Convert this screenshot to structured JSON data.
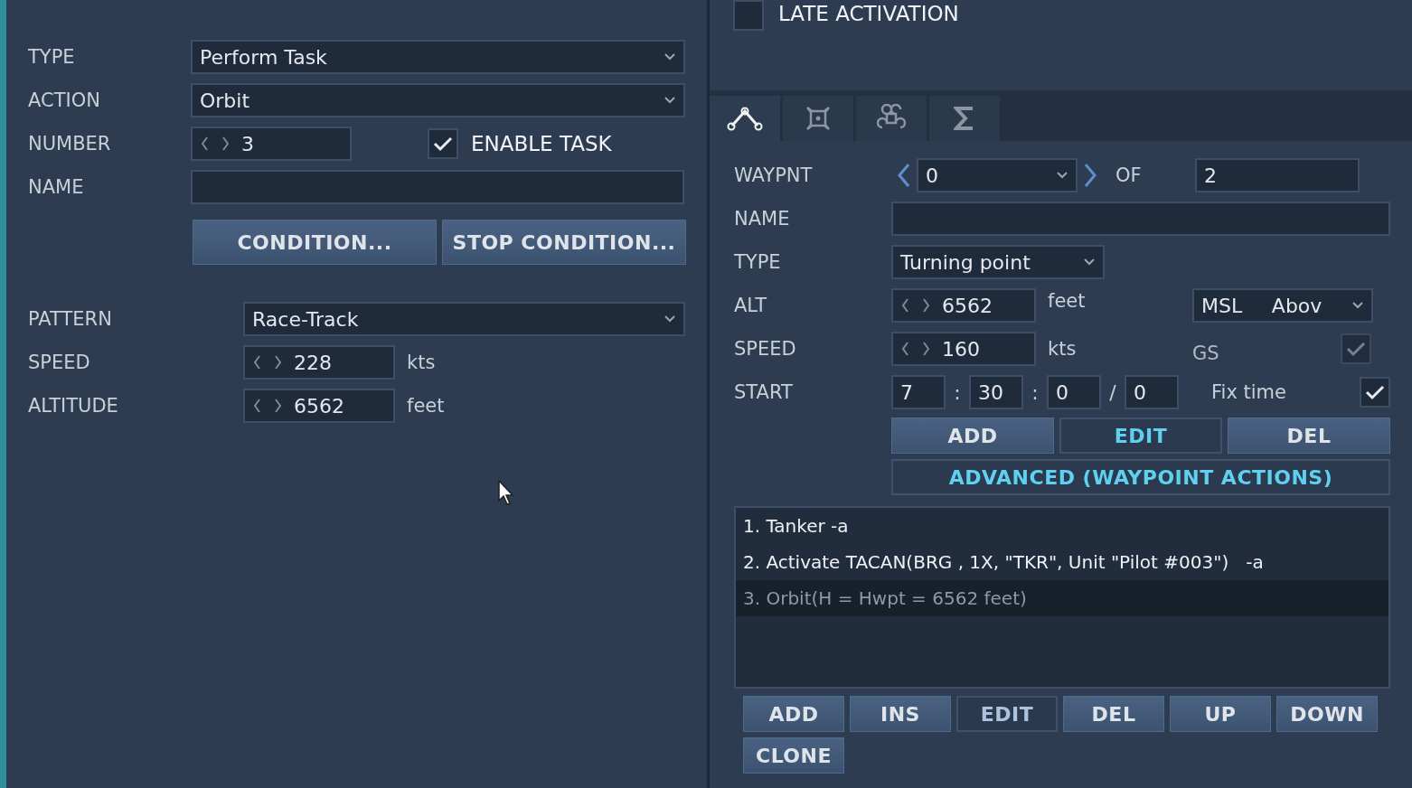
{
  "task": {
    "type": {
      "label": "TYPE",
      "value": "Perform Task"
    },
    "action": {
      "label": "ACTION",
      "value": "Orbit"
    },
    "number": {
      "label": "NUMBER",
      "value": "3"
    },
    "enable_task": {
      "label": "ENABLE TASK",
      "checked": true
    },
    "name": {
      "label": "NAME"
    },
    "buttons": [
      {
        "label": "CONDITION..."
      },
      {
        "label": "STOP CONDITION..."
      }
    ]
  },
  "orbit": {
    "pattern": {
      "label": "PATTERN",
      "value": "Race-Track"
    },
    "speed": {
      "label": "SPEED",
      "value": "228",
      "unit": "kts"
    },
    "altitude": {
      "label": "ALTITUDE",
      "value": "6562",
      "unit": "feet"
    }
  },
  "late_activation": {
    "label": "LATE ACTIVATION",
    "checked": false
  },
  "tabs": [
    {
      "kind": "route",
      "selected": true
    },
    {
      "kind": "target",
      "selected": false
    },
    {
      "kind": "command",
      "selected": false
    },
    {
      "kind": "sum",
      "selected": false
    }
  ],
  "waypoint": {
    "waypnt": {
      "label": "WAYPNT",
      "value": "0"
    },
    "of": {
      "label": "OF",
      "value": "2"
    },
    "name": {
      "label": "NAME"
    },
    "type": {
      "label": "TYPE",
      "value": "Turning point"
    },
    "alt": {
      "label": "ALT",
      "value": "6562",
      "unit": "feet",
      "ref": "MSL",
      "ref_mode": "Abov"
    },
    "speed": {
      "label": "SPEED",
      "value": "160",
      "unit": "kts"
    },
    "gs": {
      "label": "GS",
      "checked": true,
      "disabled": true
    },
    "start": {
      "label": "START",
      "parts": [
        "7",
        "30",
        "0",
        "0"
      ],
      "separators": [
        ":",
        ":",
        "/"
      ]
    },
    "fix_time": {
      "label": "Fix time",
      "checked": true,
      "disabled": false
    },
    "buttons": [
      {
        "label": "ADD",
        "kind": "raised"
      },
      {
        "label": "EDIT",
        "kind": "accent"
      },
      {
        "label": "DEL",
        "kind": "raised"
      }
    ],
    "advanced": {
      "label": "ADVANCED (WAYPOINT ACTIONS)",
      "kind": "accent"
    }
  },
  "actions": {
    "items": [
      {
        "text": "1. Tanker -a",
        "selected": false
      },
      {
        "text": "2. Activate TACAN(BRG , 1X, \"TKR\", Unit \"Pilot #003\")   -a",
        "selected": false
      },
      {
        "text": "3. Orbit(H = Hwpt = 6562 feet)",
        "selected": true
      }
    ],
    "buttons": [
      {
        "label": "ADD",
        "kind": "raised"
      },
      {
        "label": "INS",
        "kind": "raised"
      },
      {
        "label": "EDIT",
        "kind": "flat"
      },
      {
        "label": "DEL",
        "kind": "raised"
      },
      {
        "label": "UP",
        "kind": "raised"
      },
      {
        "label": "DOWN",
        "kind": "raised"
      },
      {
        "label": "CLONE",
        "kind": "raised"
      }
    ]
  }
}
